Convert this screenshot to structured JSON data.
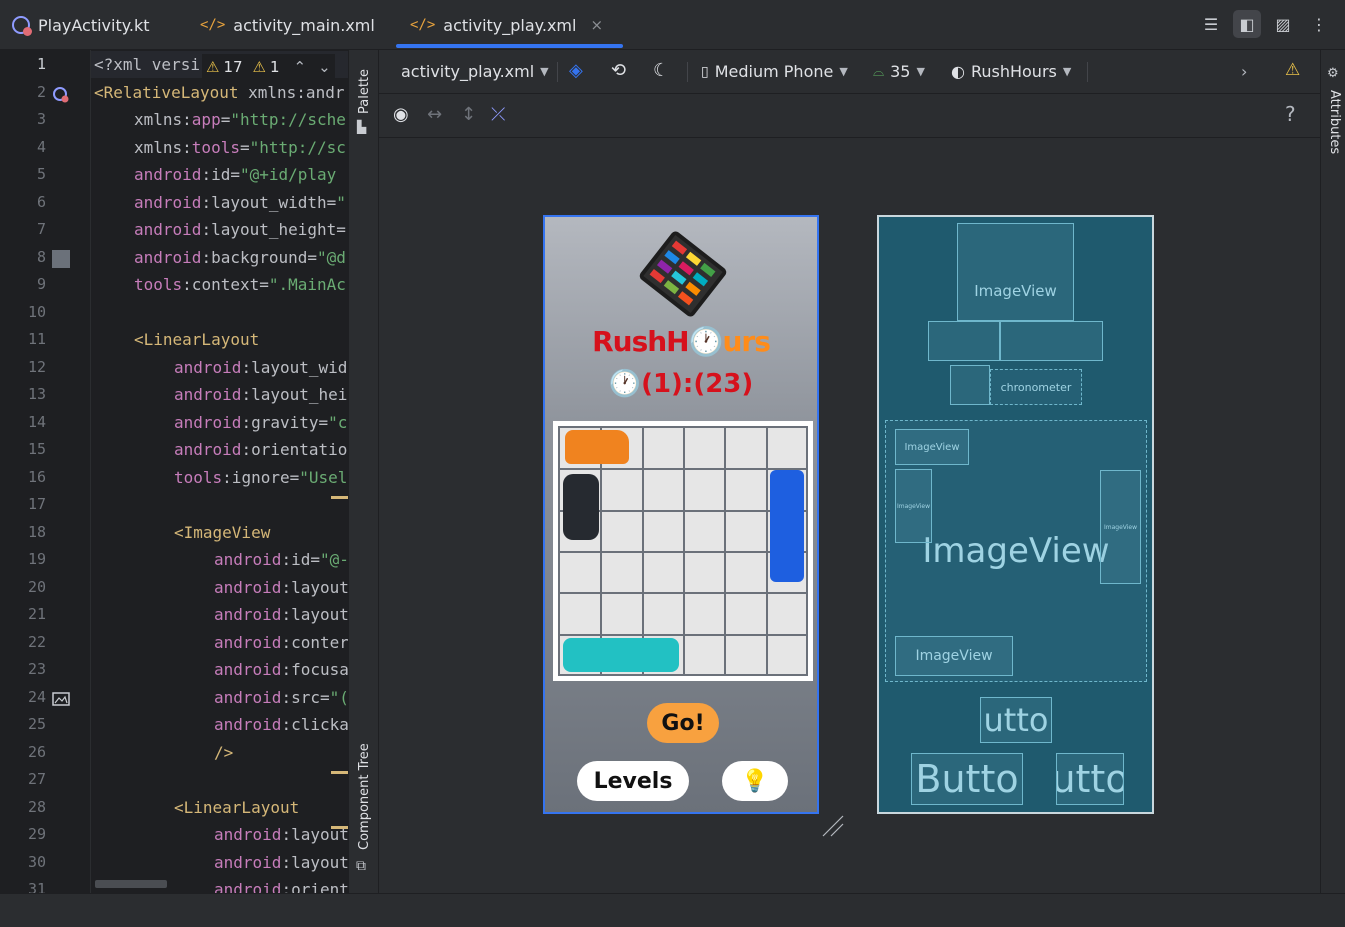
{
  "tabs": [
    {
      "label": "PlayActivity.kt",
      "icon": "kotlin-class-icon"
    },
    {
      "label": "activity_main.xml",
      "icon": "xml-file-icon"
    },
    {
      "label": "activity_play.xml",
      "icon": "xml-file-icon",
      "active": true
    }
  ],
  "tab_close_glyph": "×",
  "inspection": {
    "warnings": "17",
    "weak_warnings": "1"
  },
  "code": {
    "line_numbers": [
      "1",
      "2",
      "3",
      "4",
      "5",
      "6",
      "7",
      "8",
      "9",
      "10",
      "11",
      "12",
      "13",
      "14",
      "15",
      "16",
      "17",
      "18",
      "19",
      "20",
      "21",
      "22",
      "23",
      "24",
      "25",
      "26",
      "27",
      "28",
      "29",
      "30",
      "31"
    ],
    "lines": [
      [
        "<?xml versi"
      ],
      [
        "<RelativeLayout",
        " xmlns:andr"
      ],
      [
        "xmlns:",
        "app",
        "=",
        "\"http://sche"
      ],
      [
        "xmlns:",
        "tools",
        "=",
        "\"http://sc"
      ],
      [
        "android",
        ":id=",
        "\"@+id/play"
      ],
      [
        "android",
        ":layout_width=",
        "\""
      ],
      [
        "android",
        ":layout_height=",
        ""
      ],
      [
        "android",
        ":background=",
        "\"@d"
      ],
      [
        "tools",
        ":context=",
        "\".MainAc"
      ],
      [
        ""
      ],
      [
        "<LinearLayout"
      ],
      [
        "android",
        ":layout_wid"
      ],
      [
        "android",
        ":layout_hei"
      ],
      [
        "android",
        ":gravity=",
        "\"c"
      ],
      [
        "android",
        ":orientatio"
      ],
      [
        "tools",
        ":ignore=",
        "\"Usel"
      ],
      [
        ""
      ],
      [
        "<ImageView"
      ],
      [
        "android",
        ":id=",
        "\"@-"
      ],
      [
        "android",
        ":layout"
      ],
      [
        "android",
        ":layout"
      ],
      [
        "android",
        ":conter"
      ],
      [
        "android",
        ":focusa"
      ],
      [
        "android",
        ":src=",
        "\"("
      ],
      [
        "android",
        ":clicka"
      ],
      [
        "/>"
      ],
      [
        ""
      ],
      [
        "<LinearLayout"
      ],
      [
        "android",
        ":layout"
      ],
      [
        "android",
        ":layout"
      ],
      [
        "android",
        ":orient"
      ]
    ]
  },
  "side_panels": {
    "palette": "Palette",
    "component_tree": "Component Tree",
    "attributes": "Attributes"
  },
  "design_toolbar": {
    "file": "activity_play.xml",
    "device": "Medium Phone",
    "api": "35",
    "theme": "RushHours"
  },
  "help_glyph": "?",
  "app": {
    "title_part1": "RushH",
    "title_clock": "🕐",
    "title_part2": "urs",
    "timer": "🕐(1):(23)",
    "go_button": "Go!",
    "levels_button": "Levels",
    "hint_button": "💡"
  },
  "blueprint": {
    "imageview_top": "ImageView",
    "chronometer": "chronometer",
    "imageview_small": "ImageView",
    "imageview_tiny_left": "ImageView",
    "imageview_tiny_right": "ImageView",
    "imageview_board": "ImageView",
    "imageview_bottom": "ImageView",
    "button_go": "utto",
    "button_levels": "Butto",
    "button_hint": "utto"
  },
  "colors": {
    "accent": "#3574f0",
    "title_red": "#d6111c",
    "title_orange": "#ff8c1a",
    "go_orange": "#f8a13f",
    "blueprint_bg": "#1f5a6e"
  }
}
